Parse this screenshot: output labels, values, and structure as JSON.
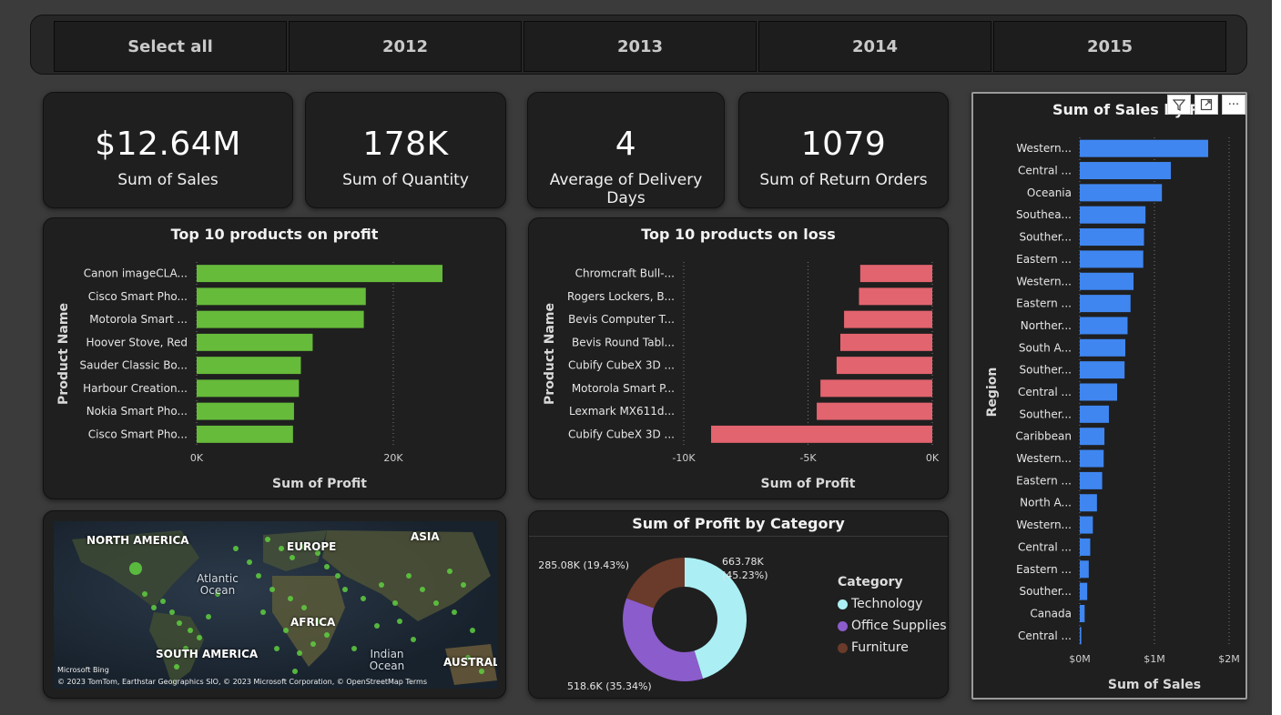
{
  "slicer": {
    "items": [
      "Select all",
      "2012",
      "2013",
      "2014",
      "2015"
    ]
  },
  "kpis": [
    {
      "value": "$12.64M",
      "label": "Sum of Sales"
    },
    {
      "value": "178K",
      "label": "Sum of Quantity"
    },
    {
      "value": "4",
      "label": "Average of Delivery Days"
    },
    {
      "value": "1079",
      "label": "Sum of Return Orders"
    }
  ],
  "visual_icons": [
    "filter-icon",
    "focus-mode-icon",
    "more-options-icon"
  ],
  "chart_data": [
    {
      "id": "profit",
      "type": "bar",
      "orientation": "horizontal",
      "title": "Top 10 products on profit",
      "xlabel": "Sum of Profit",
      "ylabel": "Product Name",
      "color": "#66bb3a",
      "categories": [
        "Canon imageCLA...",
        "Cisco Smart Pho...",
        "Motorola Smart ...",
        "Hoover Stove, Red",
        "Sauder Classic Bo...",
        "Harbour Creation...",
        "Nokia Smart Pho...",
        "Cisco Smart Pho..."
      ],
      "values": [
        25000,
        17200,
        17000,
        11800,
        10600,
        10400,
        9900,
        9800
      ],
      "xlim": [
        0,
        25000
      ],
      "xticks": [
        {
          "value": 0,
          "label": "0K"
        },
        {
          "value": 20000,
          "label": "20K"
        }
      ]
    },
    {
      "id": "loss",
      "type": "bar",
      "orientation": "horizontal",
      "title": "Top 10 products on loss",
      "xlabel": "Sum of Profit",
      "ylabel": "Product Name",
      "color": "#e2646e",
      "categories": [
        "Chromcraft Bull-...",
        "Rogers Lockers, B...",
        "Bevis Computer T...",
        "Bevis Round Tabl...",
        "Cubify CubeX 3D ...",
        "Motorola Smart P...",
        "Lexmark MX611d...",
        "Cubify CubeX 3D ..."
      ],
      "values": [
        -2900,
        -2950,
        -3550,
        -3700,
        -3850,
        -4500,
        -4650,
        -8900
      ],
      "xlim": [
        -10000,
        0
      ],
      "xticks": [
        {
          "value": -10000,
          "label": "-10K"
        },
        {
          "value": -5000,
          "label": "-5K"
        },
        {
          "value": 0,
          "label": "0K"
        }
      ]
    },
    {
      "id": "category",
      "type": "pie",
      "title": "Sum of Profit by Category",
      "legend_title": "Category",
      "slices": [
        {
          "name": "Technology",
          "value": 663.78,
          "label": "663.78K",
          "pct": "(45.23%)",
          "color": "#abeff4"
        },
        {
          "name": "Office Supplies",
          "value": 518.6,
          "label": "518.6K (35.34%)",
          "pct": "",
          "color": "#8b5ccb"
        },
        {
          "name": "Furniture",
          "value": 285.08,
          "label": "285.08K (19.43%)",
          "pct": "",
          "color": "#6a3b2a"
        }
      ]
    },
    {
      "id": "region",
      "type": "bar",
      "orientation": "horizontal",
      "title": "Sum of Sales by Re",
      "xlabel": "Sum of Sales",
      "ylabel": "Region",
      "color": "#3f86f0",
      "categories": [
        "Western...",
        "Central ...",
        "Oceania",
        "Southea...",
        "Souther...",
        "Eastern ...",
        "Western...",
        "Eastern ...",
        "Norther...",
        "South A...",
        "Souther...",
        "Central ...",
        "Souther...",
        "Caribbean",
        "Western...",
        "Eastern ...",
        "North A...",
        "Western...",
        "Central ...",
        "Eastern ...",
        "Souther...",
        "Canada",
        "Central ..."
      ],
      "values": [
        1720000,
        1220000,
        1100000,
        880000,
        860000,
        850000,
        720000,
        680000,
        640000,
        610000,
        600000,
        500000,
        390000,
        330000,
        320000,
        300000,
        230000,
        175000,
        140000,
        120000,
        100000,
        65000,
        20000
      ],
      "xlim": [
        0,
        2000000
      ],
      "xticks": [
        {
          "value": 0,
          "label": "$0M"
        },
        {
          "value": 1000000,
          "label": "$1M"
        },
        {
          "value": 2000000,
          "label": "$2M"
        }
      ]
    }
  ],
  "map": {
    "labels": [
      "NORTH AMERICA",
      "EUROPE",
      "ASIA",
      "AFRICA",
      "SOUTH AMERICA",
      "AUSTRALI"
    ],
    "oceans": [
      "Atlantic Ocean",
      "Indian Ocean"
    ],
    "attribution": "© 2023 TomTom, Earthstar Geographics SIO, © 2023 Microsoft Corporation, © OpenStreetMap  Terms",
    "brand": "Microsoft Bing",
    "point_color": "#5fcf3f"
  }
}
